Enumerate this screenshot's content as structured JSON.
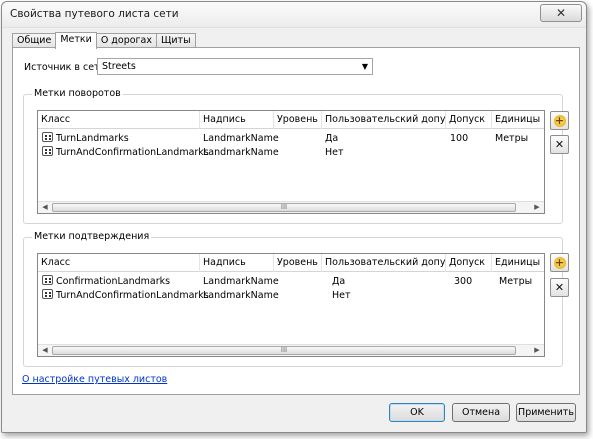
{
  "window": {
    "title": "Свойства путевого листа сети",
    "close_glyph": "✕"
  },
  "tabs": [
    {
      "label": "Общие",
      "active": false
    },
    {
      "label": "Метки",
      "active": true
    },
    {
      "label": "О дорогах",
      "active": false
    },
    {
      "label": "Щиты",
      "active": false
    }
  ],
  "source": {
    "label": "Источник в сети:",
    "value": "Streets"
  },
  "turn_group": {
    "legend": "Метки поворотов",
    "columns": [
      "Класс",
      "Надпись",
      "Уровень",
      "Пользовательский допуск",
      "Допуск",
      "Единицы"
    ],
    "rows": [
      {
        "class": "TurnLandmarks",
        "label": "LandmarkName",
        "level": "",
        "custom": "Да",
        "tolerance": "100",
        "units": "Метры"
      },
      {
        "class": "TurnAndConfirmationLandmarks",
        "label": "LandmarkName",
        "level": "",
        "custom": "Нет",
        "tolerance": "",
        "units": ""
      }
    ]
  },
  "confirm_group": {
    "legend": "Метки подтверждения",
    "columns": [
      "Класс",
      "Надпись",
      "Уровень",
      "Пользовательский допуск",
      "Допуск",
      "Единицы"
    ],
    "rows": [
      {
        "class": "ConfirmationLandmarks",
        "label": "LandmarkName",
        "level": "",
        "custom": "Да",
        "tolerance": "300",
        "units": "Метры"
      },
      {
        "class": "TurnAndConfirmationLandmarks",
        "label": "LandmarkName",
        "level": "",
        "custom": "Нет",
        "tolerance": "",
        "units": ""
      }
    ]
  },
  "scrollbar": {
    "left": "◀",
    "right": "▶",
    "grip": "III"
  },
  "icons": {
    "add": "add-layer-icon",
    "remove": "delete-icon",
    "layer": "feature-layer-icon"
  },
  "link_text": "О настройке путевых листов",
  "buttons": {
    "ok": "OK",
    "cancel": "Отмена",
    "apply": "Применить"
  }
}
